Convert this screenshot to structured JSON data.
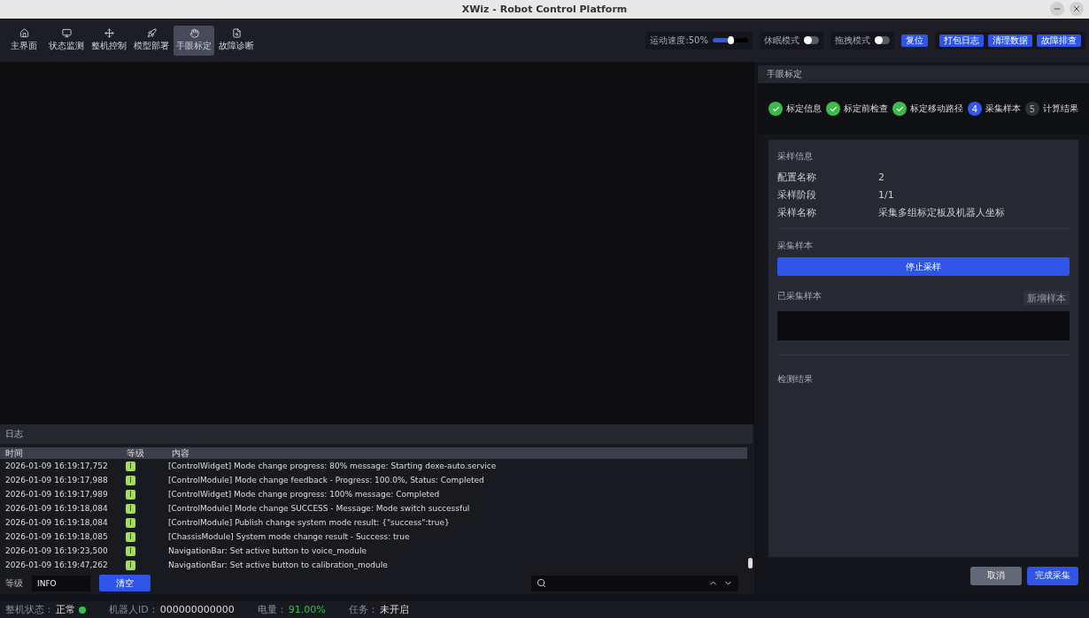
{
  "window": {
    "title": "XWiz - Robot Control Platform"
  },
  "nav": [
    {
      "label": "主界面",
      "selected": false
    },
    {
      "label": "状态监测",
      "selected": false
    },
    {
      "label": "整机控制",
      "selected": false
    },
    {
      "label": "模型部署",
      "selected": false
    },
    {
      "label": "手眼标定",
      "selected": true
    },
    {
      "label": "故障诊断",
      "selected": false
    }
  ],
  "controls": {
    "speed": {
      "label": "运动速度:50%",
      "level": 0.5
    },
    "toggles": [
      {
        "label": "休眠模式",
        "on": false
      },
      {
        "label": "拖拽模式",
        "on": false
      }
    ],
    "reset": "复位",
    "actions": [
      "打包日志",
      "清理数据",
      "故障排查"
    ]
  },
  "panel": {
    "title": "手眼标定",
    "steps": [
      {
        "label": "标定信息",
        "done": true,
        "active": false
      },
      {
        "label": "标定前检查",
        "done": true,
        "active": false
      },
      {
        "label": "标定移动路径",
        "done": true,
        "active": false
      },
      {
        "index": "4",
        "label": "采集样本",
        "done": false,
        "active": true
      },
      {
        "index": "5",
        "label": "计算结果",
        "done": false,
        "active": false
      }
    ],
    "info_title": "采样信息",
    "info": [
      {
        "key": "配置名称",
        "value": "2"
      },
      {
        "key": "采样阶段",
        "value": "1/1"
      },
      {
        "key": "采样名称",
        "value": "采集多组标定板及机器人坐标"
      }
    ],
    "collect_title": "采集样本",
    "stop_button": "停止采样",
    "samples_title": "已采集样本",
    "add_button": {
      "label": "新增样本",
      "disabled": true
    },
    "result_title": "检测结果",
    "cancel": "取消",
    "finish": "完成采集"
  },
  "log": {
    "title": "日志",
    "columns": [
      "时间",
      "等级",
      "内容"
    ],
    "rows": [
      {
        "time": "2026-01-09 16:19:17,752",
        "level": "I",
        "content": "[ControlWidget] Mode change progress: 80% message: Starting dexe-auto.service"
      },
      {
        "time": "2026-01-09 16:19:17,988",
        "level": "I",
        "content": "[ControlModule] Mode change feedback - Progress: 100.0%, Status: Completed"
      },
      {
        "time": "2026-01-09 16:19:17,989",
        "level": "I",
        "content": "[ControlWidget] Mode change progress: 100% message: Completed"
      },
      {
        "time": "2026-01-09 16:19:18,084",
        "level": "I",
        "content": "[ControlModule] Mode change SUCCESS - Message: Mode switch successful"
      },
      {
        "time": "2026-01-09 16:19:18,084",
        "level": "I",
        "content": "[ControlModule] Publish change system mode result: {\"success\":true}"
      },
      {
        "time": "2026-01-09 16:19:18,085",
        "level": "I",
        "content": "[ChassisModule] System mode change result - Success: true"
      },
      {
        "time": "2026-01-09 16:19:23,500",
        "level": "I",
        "content": "NavigationBar: Set active button to voice_module"
      },
      {
        "time": "2026-01-09 16:19:47,262",
        "level": "I",
        "content": "NavigationBar: Set active button to calibration_module"
      }
    ],
    "level_label": "等级",
    "level_value": "INFO",
    "clear": "清空"
  },
  "status": [
    {
      "label": "整机状态：",
      "value": "正常",
      "kind": "dot",
      "color": "#2ec44f"
    },
    {
      "label": "机器人ID：",
      "value": "000000000000",
      "kind": "text"
    },
    {
      "label": "电量：",
      "value": "91.00%",
      "kind": "good"
    },
    {
      "label": "任务：",
      "value": "未开启",
      "kind": "text"
    }
  ]
}
